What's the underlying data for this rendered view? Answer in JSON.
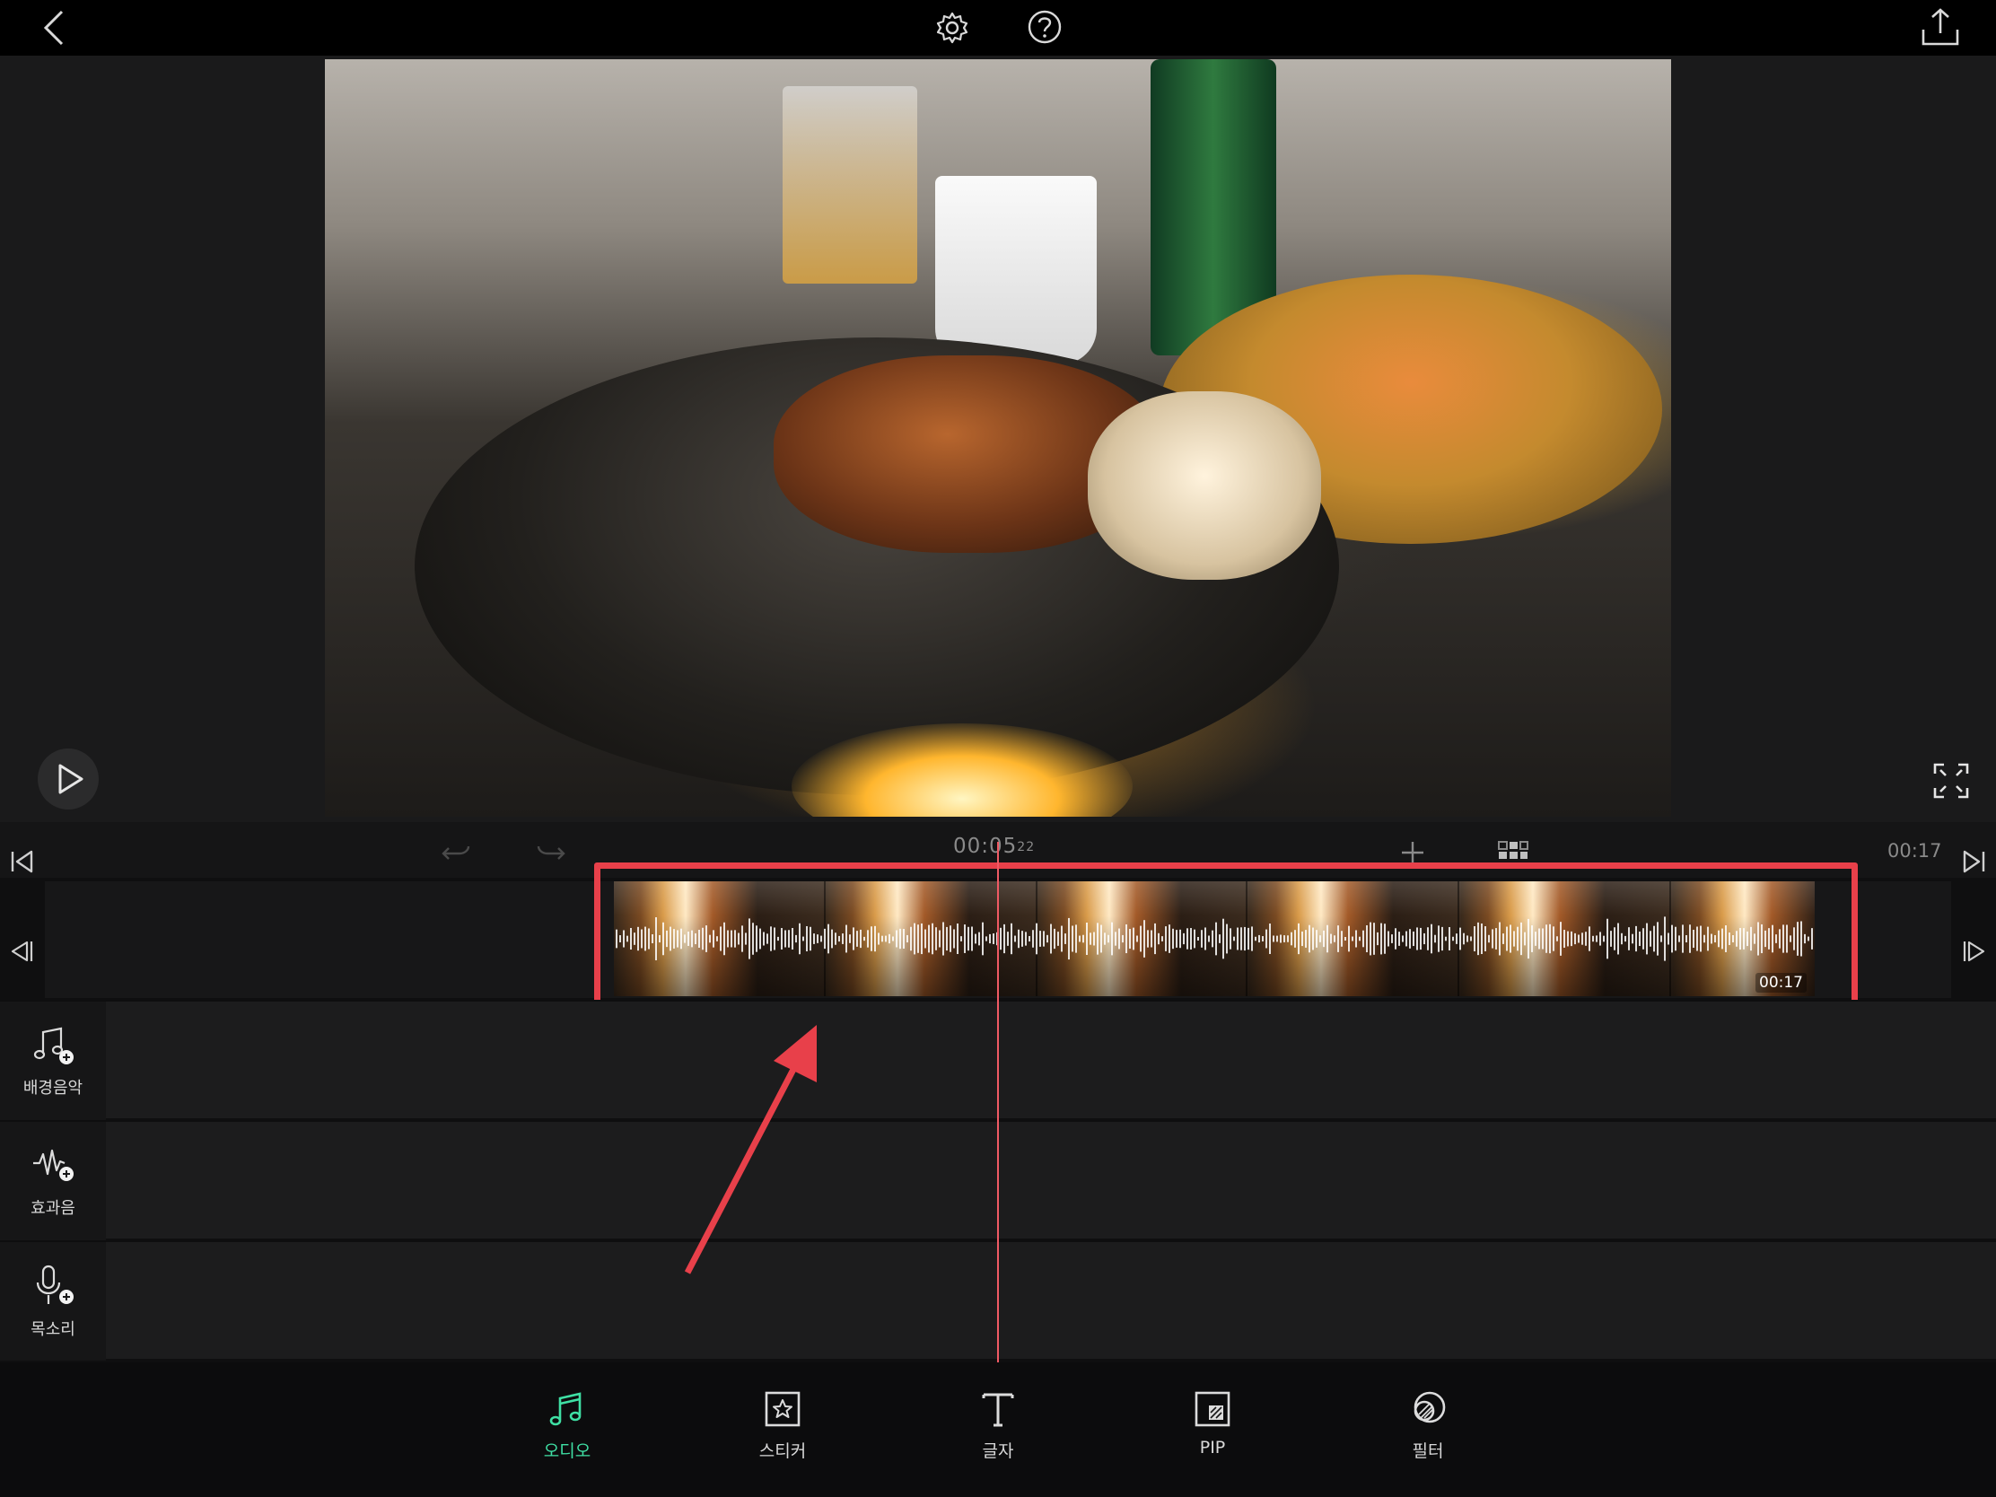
{
  "topbar": {
    "back_icon": "chevron-left-icon",
    "settings_icon": "gear-icon",
    "help_icon": "question-circle-icon",
    "export_icon": "share-upload-icon"
  },
  "preview": {
    "play_icon": "play-icon",
    "fullscreen_icon": "fullscreen-icon"
  },
  "timeline": {
    "current_time": "00:05",
    "current_frame": "22",
    "total_time": "00:17",
    "undo_icon": "undo-icon",
    "redo_icon": "redo-icon",
    "add_icon": "plus-icon",
    "grid_icon": "grid-icon",
    "jump_start_icon": "skip-start-icon",
    "jump_end_icon": "skip-end-icon"
  },
  "video_clip": {
    "duration": "00:17"
  },
  "audio_tracks": [
    {
      "label": "배경음악",
      "icon": "music-add-icon"
    },
    {
      "label": "효과음",
      "icon": "sound-effect-add-icon"
    },
    {
      "label": "목소리",
      "icon": "microphone-add-icon"
    }
  ],
  "bottom_menu": {
    "active_color": "#3fe0a4",
    "items": [
      {
        "label": "오디오",
        "icon": "music-note-icon",
        "active": true
      },
      {
        "label": "스티커",
        "icon": "sticker-star-icon",
        "active": false
      },
      {
        "label": "글자",
        "icon": "text-icon",
        "active": false
      },
      {
        "label": "PIP",
        "icon": "pip-icon",
        "active": false
      },
      {
        "label": "필터",
        "icon": "filter-icon",
        "active": false
      }
    ]
  },
  "annotation": {
    "color": "#e8404a"
  }
}
